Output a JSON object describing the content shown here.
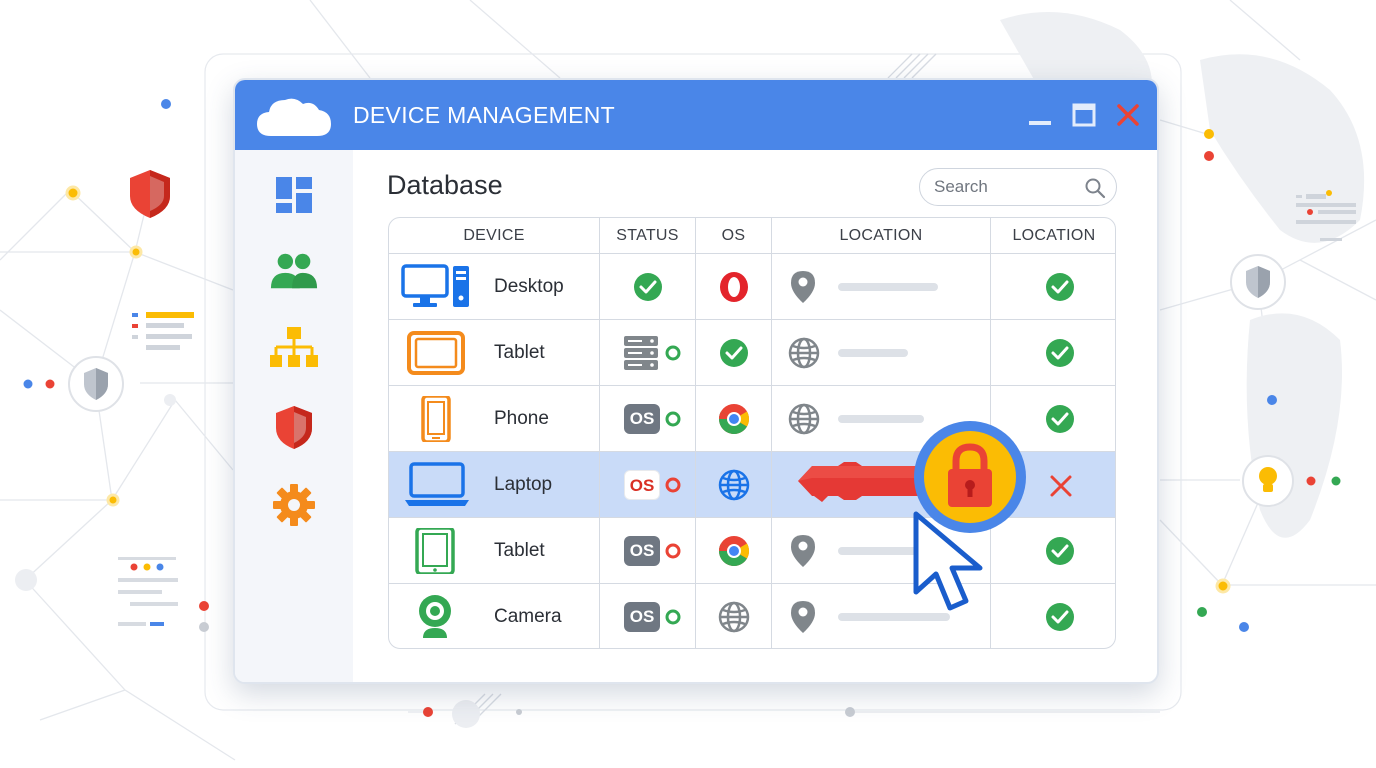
{
  "window": {
    "title": "DEVICE MANAGEMENT",
    "controls": [
      "minimize-icon",
      "maximize-icon",
      "close-icon"
    ]
  },
  "sidebar": {
    "items": [
      {
        "name": "dashboard",
        "icon": "dashboard-icon",
        "color": "#4a86e8"
      },
      {
        "name": "users",
        "icon": "users-icon",
        "color": "#34a853"
      },
      {
        "name": "hierarchy",
        "icon": "hierarchy-icon",
        "color": "#fbbc04"
      },
      {
        "name": "security",
        "icon": "shield-icon",
        "color": "#ea4335"
      },
      {
        "name": "settings",
        "icon": "gear-icon",
        "color": "#f48b1c"
      }
    ]
  },
  "main": {
    "title": "Database",
    "search": {
      "placeholder": "Search",
      "value": ""
    }
  },
  "table": {
    "columns": [
      "DEVICE",
      "STATUS",
      "OS",
      "LOCATION",
      "LOCATION"
    ],
    "rows": [
      {
        "device": "Desktop",
        "device_icon": "desktop-icon",
        "status": "check-icon",
        "os": "opera-icon",
        "location": "pin-icon",
        "state": "check-icon"
      },
      {
        "device": "Tablet",
        "device_icon": "tablet-icon",
        "status": "server-icon",
        "os": "check-icon",
        "location": "globe-icon",
        "state": "check-icon"
      },
      {
        "device": "Phone",
        "device_icon": "phone-icon",
        "status": "OS",
        "os": "chrome-icon",
        "location": "globe-icon",
        "state": "check-icon"
      },
      {
        "device": "Laptop",
        "device_icon": "laptop-icon",
        "status": "OS",
        "os": "globe-icon",
        "location": "key-icon",
        "state": "x-icon",
        "selected": true
      },
      {
        "device": "Tablet",
        "device_icon": "tablet-icon",
        "status": "OS",
        "os": "chrome-icon",
        "location": "pin-icon",
        "state": "check-icon"
      },
      {
        "device": "Camera",
        "device_icon": "webcam-icon",
        "status": "OS",
        "os": "globe-icon",
        "location": "pin-icon",
        "state": "check-icon"
      }
    ]
  },
  "colors": {
    "accent": "#4a86e8",
    "success": "#34a853",
    "danger": "#ea4335",
    "warning": "#fbbc04",
    "selected_row": "#c9dbf8"
  }
}
